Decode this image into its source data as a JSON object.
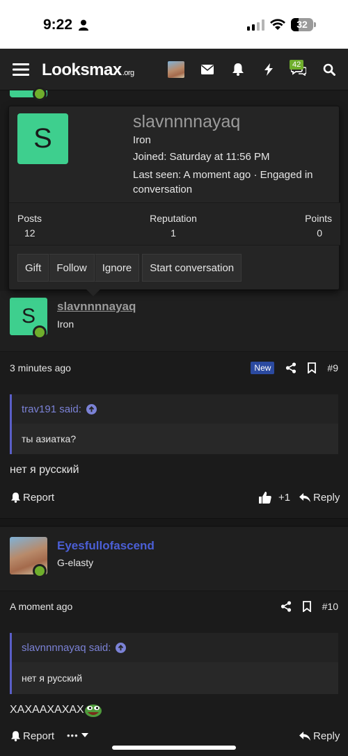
{
  "status_bar": {
    "time": "9:22",
    "battery": "32"
  },
  "nav": {
    "logo_main": "Looksmax",
    "logo_suffix": ".org",
    "conversations_badge": "42"
  },
  "profile_card": {
    "avatar_letter": "S",
    "username": "slavnnnnayaq",
    "title": "Iron",
    "joined": "Joined: Saturday at 11:56 PM",
    "last_seen": "Last seen: A moment ago · Engaged in conversation",
    "stats": [
      {
        "label": "Posts",
        "value": "12"
      },
      {
        "label": "Reputation",
        "value": "1"
      },
      {
        "label": "Points",
        "value": "0"
      }
    ],
    "actions": {
      "gift": "Gift",
      "follow": "Follow",
      "ignore": "Ignore",
      "start_conversation": "Start conversation"
    }
  },
  "posts": [
    {
      "avatar_letter": "S",
      "username": "slavnnnnayaq",
      "user_title": "Iron",
      "time": "3 minutes ago",
      "new_label": "New",
      "number": "#9",
      "quote_author": "trav191 said:",
      "quote_text": "ты азиатка?",
      "text": "нет я русский",
      "report": "Report",
      "likes": "+1",
      "reply": "Reply"
    },
    {
      "username": "Eyesfullofascend",
      "user_title": "G-elasty",
      "time": "A moment ago",
      "number": "#10",
      "quote_author": "slavnnnnayaq said:",
      "quote_text": "нет я русский",
      "text": "ХАХААХАХАХ",
      "report": "Report",
      "more": "•••",
      "reply": "Reply"
    }
  ],
  "colors": {
    "accent_green": "#3ecf8e",
    "online": "#6fae2c",
    "link_blue": "#4b5fd6",
    "quote_bar": "#5a5fc8",
    "new_badge": "#2b4aa0"
  }
}
